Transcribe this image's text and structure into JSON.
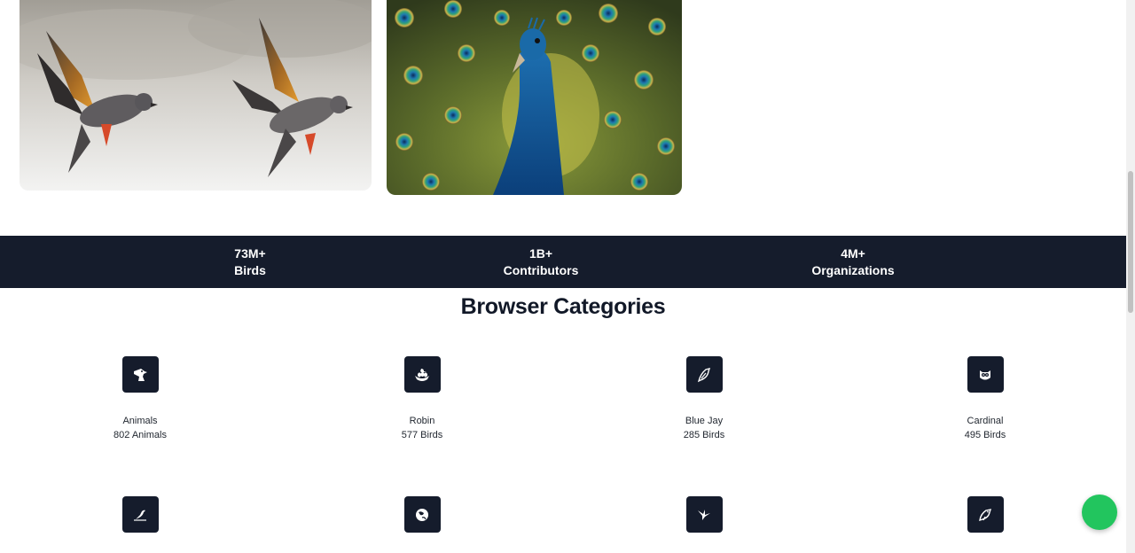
{
  "stats": [
    {
      "value": "73M+",
      "label": "Birds"
    },
    {
      "value": "1B+",
      "label": "Contributors"
    },
    {
      "value": "4M+",
      "label": "Organizations"
    }
  ],
  "categories_section": {
    "title": "Browser Categories",
    "row1": [
      {
        "name": "Animals",
        "count": "802 Animals",
        "icon": "eagle-head-icon"
      },
      {
        "name": "Robin",
        "count": "577 Birds",
        "icon": "nest-icon"
      },
      {
        "name": "Blue Jay",
        "count": "285 Birds",
        "icon": "bird-outline-icon"
      },
      {
        "name": "Cardinal",
        "count": "495 Birds",
        "icon": "owl-icon"
      }
    ],
    "row2": [
      {
        "icon": "perched-bird-icon"
      },
      {
        "icon": "globe-bird-icon"
      },
      {
        "icon": "hummingbird-icon"
      },
      {
        "icon": "songbird-icon"
      }
    ]
  },
  "colors": {
    "dark_band": "#151c2c",
    "fab": "#22c55e"
  }
}
